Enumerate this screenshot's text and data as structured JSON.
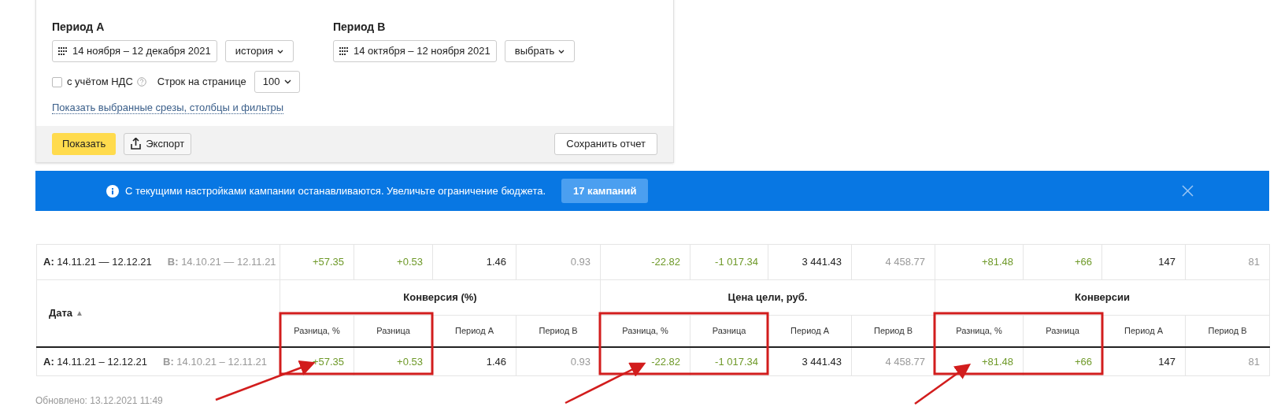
{
  "filters": {
    "periods": [
      {
        "label": "Период А",
        "date_range": "14 ноября – 12 декабря 2021",
        "preset": "история"
      },
      {
        "label": "Период В",
        "date_range": "14 октября – 12 ноября 2021",
        "preset": "выбрать"
      }
    ],
    "vat": {
      "label": "с учётом НДС",
      "checked": false
    },
    "rows_per_page": {
      "label": "Строк на странице",
      "value": "100"
    },
    "show_link": "Показать выбранные срезы, столбцы и фильтры",
    "buttons": [
      {
        "label": "Показать",
        "kind": "primary"
      },
      {
        "label": "Экспорт",
        "kind": "export"
      },
      {
        "label": "Сохранить отчет",
        "kind": "save"
      }
    ]
  },
  "banner": {
    "message": "С текущими настройками кампании останавливаются. Увеличьте ограничение бюджета.",
    "action": "17 кампаний"
  },
  "table": {
    "date_header": "Дата",
    "sort_indicator": "▲",
    "groups": [
      {
        "title": "Конверсия (%)",
        "columns": [
          {
            "label": "Разница, %",
            "kind": "diff"
          },
          {
            "label": "Разница",
            "kind": "diff"
          },
          {
            "label": "Период А",
            "kind": "a"
          },
          {
            "label": "Период В",
            "kind": "b"
          }
        ]
      },
      {
        "title": "Цена цели, руб.",
        "columns": [
          {
            "label": "Разница, %",
            "kind": "diff"
          },
          {
            "label": "Разница",
            "kind": "diff"
          },
          {
            "label": "Период А",
            "kind": "a"
          },
          {
            "label": "Период В",
            "kind": "b"
          }
        ]
      },
      {
        "title": "Конверсии",
        "columns": [
          {
            "label": "Разница, %",
            "kind": "diff"
          },
          {
            "label": "Разница",
            "kind": "diff"
          },
          {
            "label": "Период А",
            "kind": "a"
          },
          {
            "label": "Период В",
            "kind": "b"
          }
        ]
      }
    ],
    "total_row": {
      "a_label": "A:",
      "a_range": "14.11.21 — 12.12.21",
      "b_label": "B:",
      "b_range": "14.10.21 — 12.11.21",
      "values": [
        "+57.35",
        "+0.53",
        "1.46",
        "0.93",
        "-22.82",
        "-1 017.34",
        "3 441.43",
        "4 458.77",
        "+81.48",
        "+66",
        "147",
        "81"
      ]
    },
    "rows": [
      {
        "a_label": "A:",
        "a_range": "14.11.21 – 12.12.21",
        "b_label": "B:",
        "b_range": "14.10.21 – 12.11.21",
        "values": [
          "+57.35",
          "+0.53",
          "1.46",
          "0.93",
          "-22.82",
          "-1 017.34",
          "3 441.43",
          "4 458.77",
          "+81.48",
          "+66",
          "147",
          "81"
        ]
      }
    ]
  },
  "updated": "Обновлено: 13.12.2021 11:49"
}
